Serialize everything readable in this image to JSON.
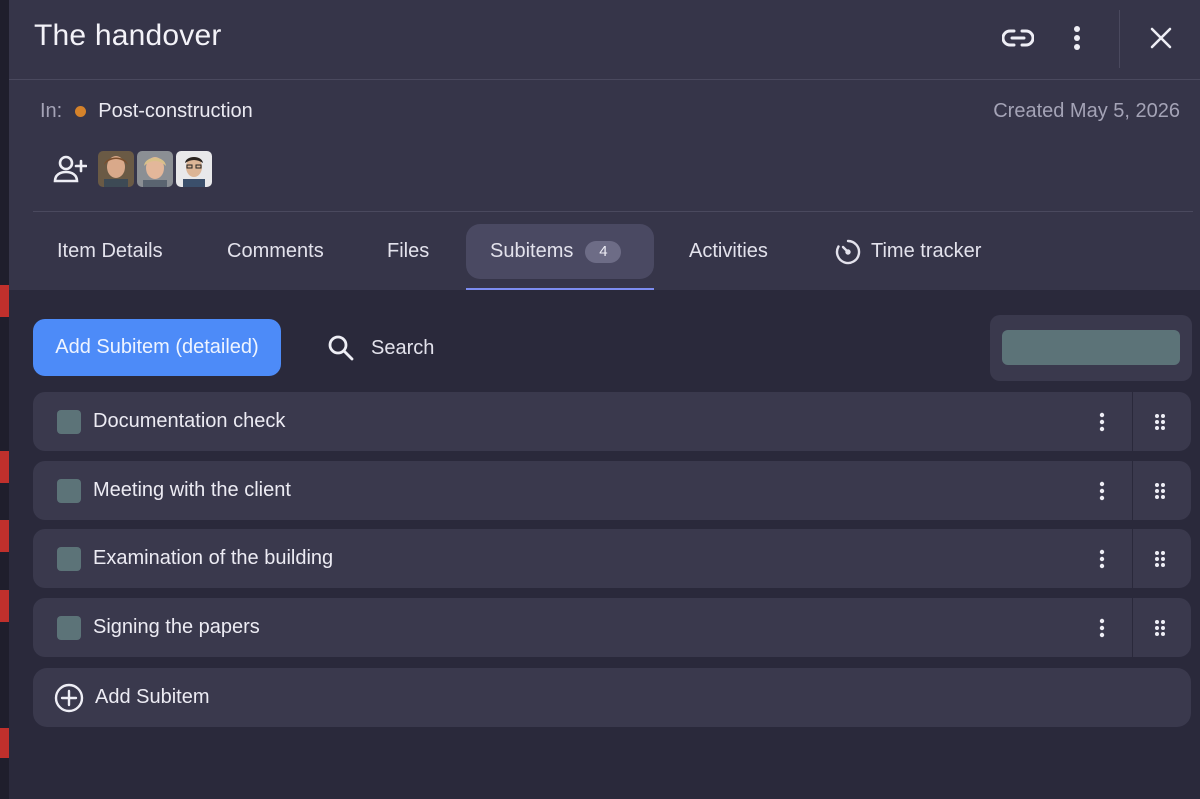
{
  "header": {
    "title": "The handover",
    "link_icon": "link-icon",
    "more_icon": "more-vertical-icon",
    "close_icon": "close-icon"
  },
  "meta": {
    "in_label": "In:",
    "group_name": "Post-construction",
    "group_color": "#d5822a",
    "created": "Created May 5, 2026"
  },
  "people": {
    "add_icon": "add-person-icon",
    "avatars": [
      "avatar-1",
      "avatar-2",
      "avatar-3"
    ]
  },
  "tabs": [
    {
      "label": "Item Details"
    },
    {
      "label": "Comments"
    },
    {
      "label": "Files"
    },
    {
      "label": "Subitems",
      "badge": "4",
      "active": true
    },
    {
      "label": "Activities"
    },
    {
      "label": "Time tracker",
      "icon": "timer-icon"
    }
  ],
  "toolbar": {
    "add_detailed_label": "Add Subitem (detailed)",
    "search_label": "Search",
    "accent_color": "#4d8bf8"
  },
  "subitems": [
    {
      "label": "Documentation check"
    },
    {
      "label": "Meeting with the client"
    },
    {
      "label": "Examination of the building"
    },
    {
      "label": "Signing the papers"
    }
  ],
  "add_subitem_label": "Add Subitem"
}
